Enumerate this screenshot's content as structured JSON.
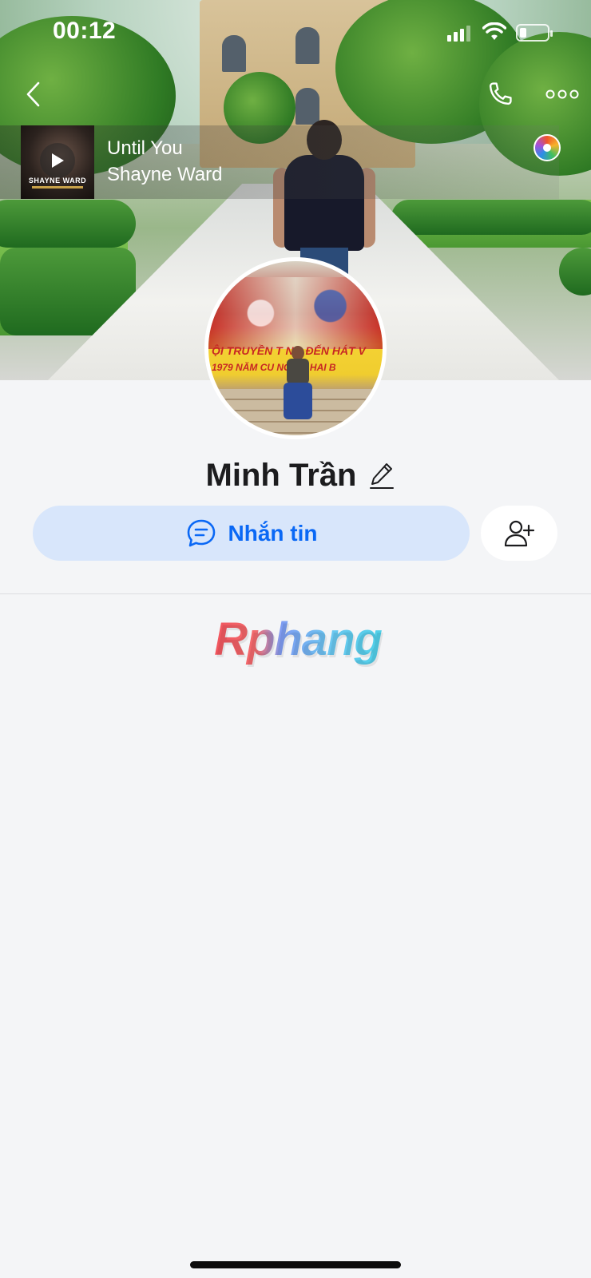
{
  "status_bar": {
    "time": "00:12"
  },
  "music": {
    "album_artist": "SHAYNE WARD",
    "title": "Until You",
    "artist": "Shayne Ward"
  },
  "profile": {
    "name": "Minh Trần"
  },
  "avatar_photo": {
    "banner_line1": "ỘI TRUYỀN T   NG ĐẾN HÁT V",
    "banner_line2": "1979 NĂM CU    NGHĨA HAI B"
  },
  "actions": {
    "message_label": "Nhắn tin"
  },
  "watermark": {
    "text": "Rphang"
  },
  "colors": {
    "accent": "#0a68f5",
    "message_bg": "#d8e6fb",
    "background": "#f4f5f7"
  },
  "icons": {
    "back": "chevron-left-icon",
    "call": "phone-icon",
    "more": "more-dots-icon",
    "play": "play-icon",
    "music_disc": "music-disc-icon",
    "edit": "pencil-icon",
    "message": "chat-bubble-icon",
    "add_friend": "add-user-icon"
  }
}
